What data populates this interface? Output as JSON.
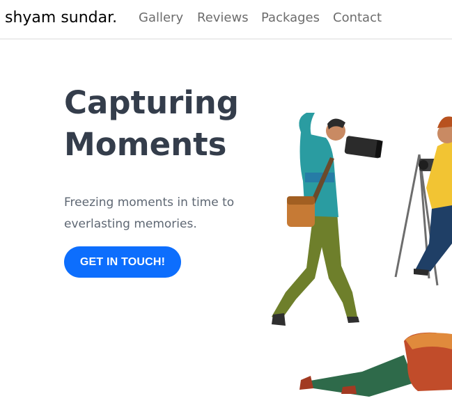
{
  "navbar": {
    "brand": "shyam sundar.",
    "links": [
      "Gallery",
      "Reviews",
      "Packages",
      "Contact"
    ]
  },
  "hero": {
    "title_line1": "Capturing",
    "title_line2": "Moments",
    "text_line1": "Freezing moments in time to",
    "text_line2": "everlasting memories.",
    "cta_label": "GET IN TOUCH!"
  },
  "colors": {
    "primary": "#0d6efd",
    "heading": "#343d4b",
    "body_text": "#5e6773",
    "nav_text": "#6c6c6c"
  },
  "illustration": {
    "name": "photographers-illustration"
  }
}
